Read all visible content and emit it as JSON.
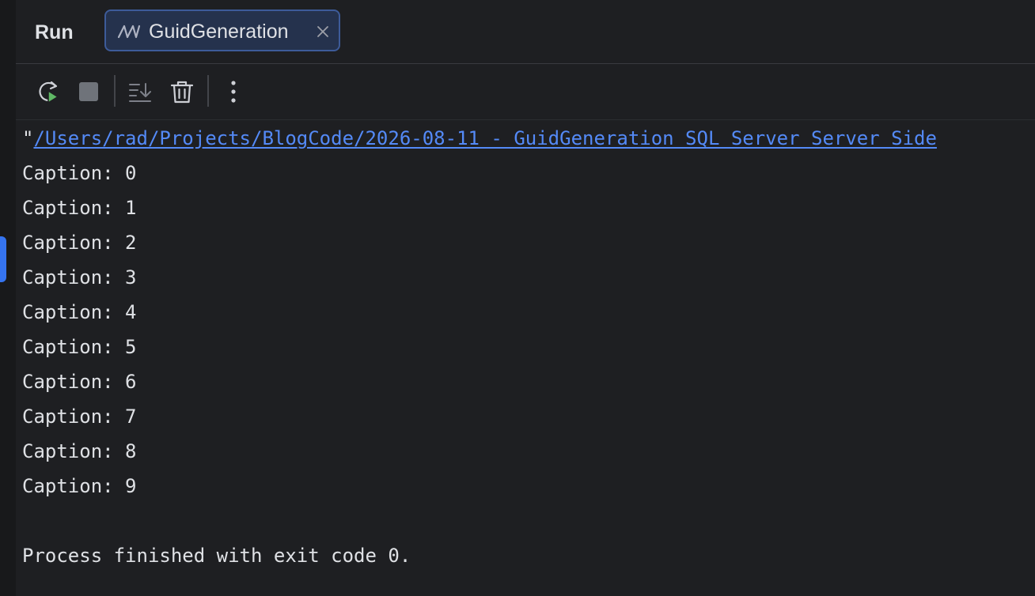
{
  "header": {
    "title": "Run",
    "tab": {
      "label": "GuidGeneration",
      "icon": "dotnet-run-config-icon"
    }
  },
  "toolbar": {
    "buttons": [
      {
        "icon": "rerun-icon"
      },
      {
        "icon": "stop-icon"
      },
      {
        "icon": "scroll-to-end-icon"
      },
      {
        "icon": "clear-console-icon"
      },
      {
        "icon": "more-options-icon"
      }
    ]
  },
  "console": {
    "command_quote": "\"",
    "command_path": "/Users/rad/Projects/BlogCode/2026-08-11 - GuidGeneration SQL Server Server Side",
    "lines": [
      "Caption: 0",
      "Caption: 1",
      "Caption: 2",
      "Caption: 3",
      "Caption: 4",
      "Caption: 5",
      "Caption: 6",
      "Caption: 7",
      "Caption: 8",
      "Caption: 9"
    ],
    "exit_message": "Process finished with exit code 0."
  },
  "colors": {
    "background": "#1e1f22",
    "accent": "#3574f0",
    "link": "#548af7",
    "text": "#dfe1e5",
    "run_green": "#5fb865"
  }
}
